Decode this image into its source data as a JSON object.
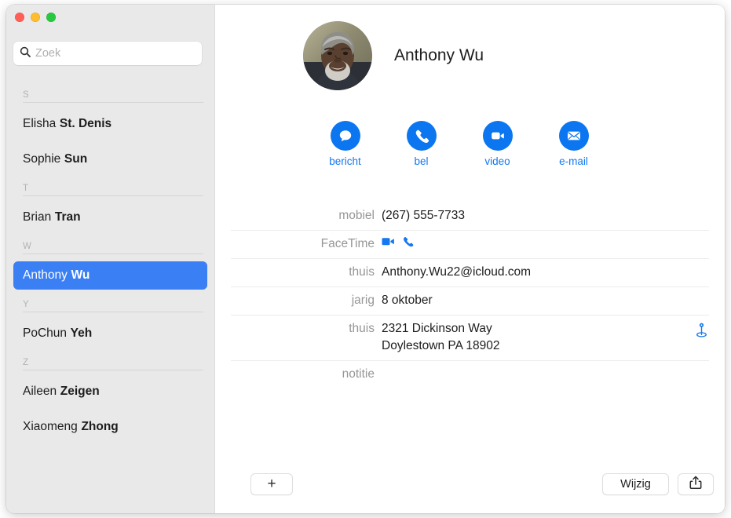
{
  "window": {
    "traffic_lights": [
      {
        "name": "close",
        "color": "#ff5f57"
      },
      {
        "name": "minimize",
        "color": "#febc2e"
      },
      {
        "name": "zoom",
        "color": "#28c840"
      }
    ]
  },
  "sidebar": {
    "search": {
      "placeholder": "Zoek",
      "value": "",
      "icon": "search-icon"
    },
    "sections": [
      {
        "letter": "S",
        "contacts": [
          {
            "first": "Elisha",
            "last": "St. Denis",
            "selected": false
          },
          {
            "first": "Sophie",
            "last": "Sun",
            "selected": false
          }
        ]
      },
      {
        "letter": "T",
        "contacts": [
          {
            "first": "Brian",
            "last": "Tran",
            "selected": false
          }
        ]
      },
      {
        "letter": "W",
        "contacts": [
          {
            "first": "Anthony",
            "last": "Wu",
            "selected": true
          }
        ]
      },
      {
        "letter": "Y",
        "contacts": [
          {
            "first": "PoChun",
            "last": "Yeh",
            "selected": false
          }
        ]
      },
      {
        "letter": "Z",
        "contacts": [
          {
            "first": "Aileen",
            "last": "Zeigen",
            "selected": false
          },
          {
            "first": "Xiaomeng",
            "last": "Zhong",
            "selected": false
          }
        ]
      }
    ],
    "selected_color": "#3b7ff5",
    "background_color": "#e9e9e9"
  },
  "detail": {
    "contact_name": "Anthony Wu",
    "avatar": {
      "icon": "contact-photo",
      "description": "photo of a smiling man with gray beard"
    },
    "actions": [
      {
        "label": "bericht",
        "icon": "message-icon"
      },
      {
        "label": "bel",
        "icon": "phone-icon"
      },
      {
        "label": "video",
        "icon": "video-camera-icon"
      },
      {
        "label": "e-mail",
        "icon": "envelope-icon"
      }
    ],
    "action_color": "#0b76f0",
    "action_label_color": "#1478f0",
    "fields": [
      {
        "label": "mobiel",
        "value": "(267) 555-7733",
        "type": "text"
      },
      {
        "label": "FaceTime",
        "value": "",
        "type": "facetime-icons"
      },
      {
        "label": "thuis",
        "value": "Anthony.Wu22@icloud.com",
        "type": "text"
      },
      {
        "label": "jarig",
        "value": "8 oktober",
        "type": "text"
      },
      {
        "label": "thuis",
        "value": "2321 Dickinson Way",
        "value2": "Doylestown PA 18902",
        "type": "address"
      },
      {
        "label": "notitie",
        "value": "",
        "type": "text"
      }
    ]
  },
  "toolbar": {
    "add_label": "+",
    "edit_label": "Wijzig",
    "share_icon": "share-icon"
  }
}
